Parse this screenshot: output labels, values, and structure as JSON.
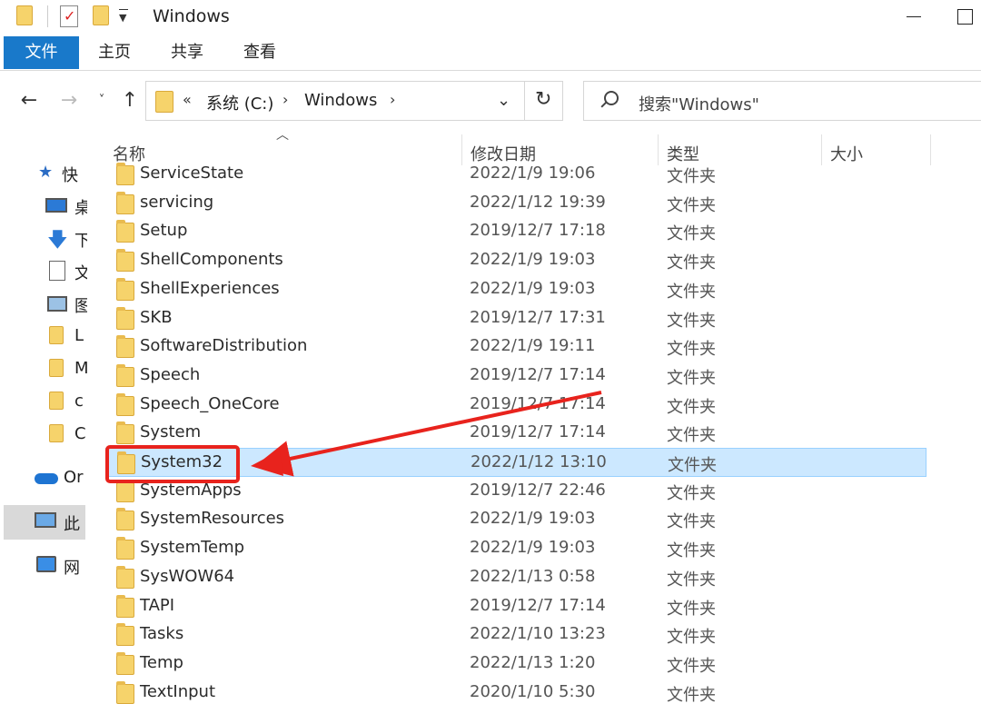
{
  "window": {
    "title": "Windows",
    "colors": {
      "accent": "#1979ca",
      "selected_row": "#cce8ff",
      "annotation": "#e8231d",
      "folder": "#f6d36b"
    }
  },
  "ribbon": {
    "file": "文件",
    "tabs": [
      "主页",
      "共享",
      "查看"
    ]
  },
  "nav": {
    "address": {
      "prefix": "«",
      "segments": [
        "系统 (C:)",
        "Windows"
      ]
    },
    "search_placeholder": "搜索\"Windows\""
  },
  "navpane": {
    "items": [
      {
        "icon": "star-icon",
        "label": "快"
      },
      {
        "icon": "desktop-icon",
        "label": "桌"
      },
      {
        "icon": "download-icon",
        "label": "下"
      },
      {
        "icon": "document-icon",
        "label": "文"
      },
      {
        "icon": "picture-icon",
        "label": "图"
      },
      {
        "icon": "folder-icon",
        "label": "L"
      },
      {
        "icon": "folder-icon",
        "label": "M"
      },
      {
        "icon": "folder-icon",
        "label": "c"
      },
      {
        "icon": "folder-icon",
        "label": "C"
      },
      {
        "icon": "onedrive-icon",
        "label": "Or"
      },
      {
        "icon": "this-pc-icon",
        "label": "此"
      },
      {
        "icon": "network-icon",
        "label": "网"
      }
    ]
  },
  "columns": [
    "名称",
    "修改日期",
    "类型",
    "大小"
  ],
  "files": [
    {
      "name": "ServiceState",
      "date": "2022/1/9 19:06",
      "type": "文件夹"
    },
    {
      "name": "servicing",
      "date": "2022/1/12 19:39",
      "type": "文件夹"
    },
    {
      "name": "Setup",
      "date": "2019/12/7 17:18",
      "type": "文件夹"
    },
    {
      "name": "ShellComponents",
      "date": "2022/1/9 19:03",
      "type": "文件夹"
    },
    {
      "name": "ShellExperiences",
      "date": "2022/1/9 19:03",
      "type": "文件夹"
    },
    {
      "name": "SKB",
      "date": "2019/12/7 17:31",
      "type": "文件夹"
    },
    {
      "name": "SoftwareDistribution",
      "date": "2022/1/9 19:11",
      "type": "文件夹"
    },
    {
      "name": "Speech",
      "date": "2019/12/7 17:14",
      "type": "文件夹"
    },
    {
      "name": "Speech_OneCore",
      "date": "2019/12/7 17:14",
      "type": "文件夹"
    },
    {
      "name": "System",
      "date": "2019/12/7 17:14",
      "type": "文件夹"
    },
    {
      "name": "System32",
      "date": "2022/1/12 13:10",
      "type": "文件夹",
      "selected": true
    },
    {
      "name": "SystemApps",
      "date": "2019/12/7 22:46",
      "type": "文件夹"
    },
    {
      "name": "SystemResources",
      "date": "2022/1/9 19:03",
      "type": "文件夹"
    },
    {
      "name": "SystemTemp",
      "date": "2022/1/9 19:03",
      "type": "文件夹"
    },
    {
      "name": "SysWOW64",
      "date": "2022/1/13 0:58",
      "type": "文件夹"
    },
    {
      "name": "TAPI",
      "date": "2019/12/7 17:14",
      "type": "文件夹"
    },
    {
      "name": "Tasks",
      "date": "2022/1/10 13:23",
      "type": "文件夹"
    },
    {
      "name": "Temp",
      "date": "2022/1/13 1:20",
      "type": "文件夹"
    },
    {
      "name": "TextInput",
      "date": "2020/1/10 5:30",
      "type": "文件夹"
    }
  ]
}
